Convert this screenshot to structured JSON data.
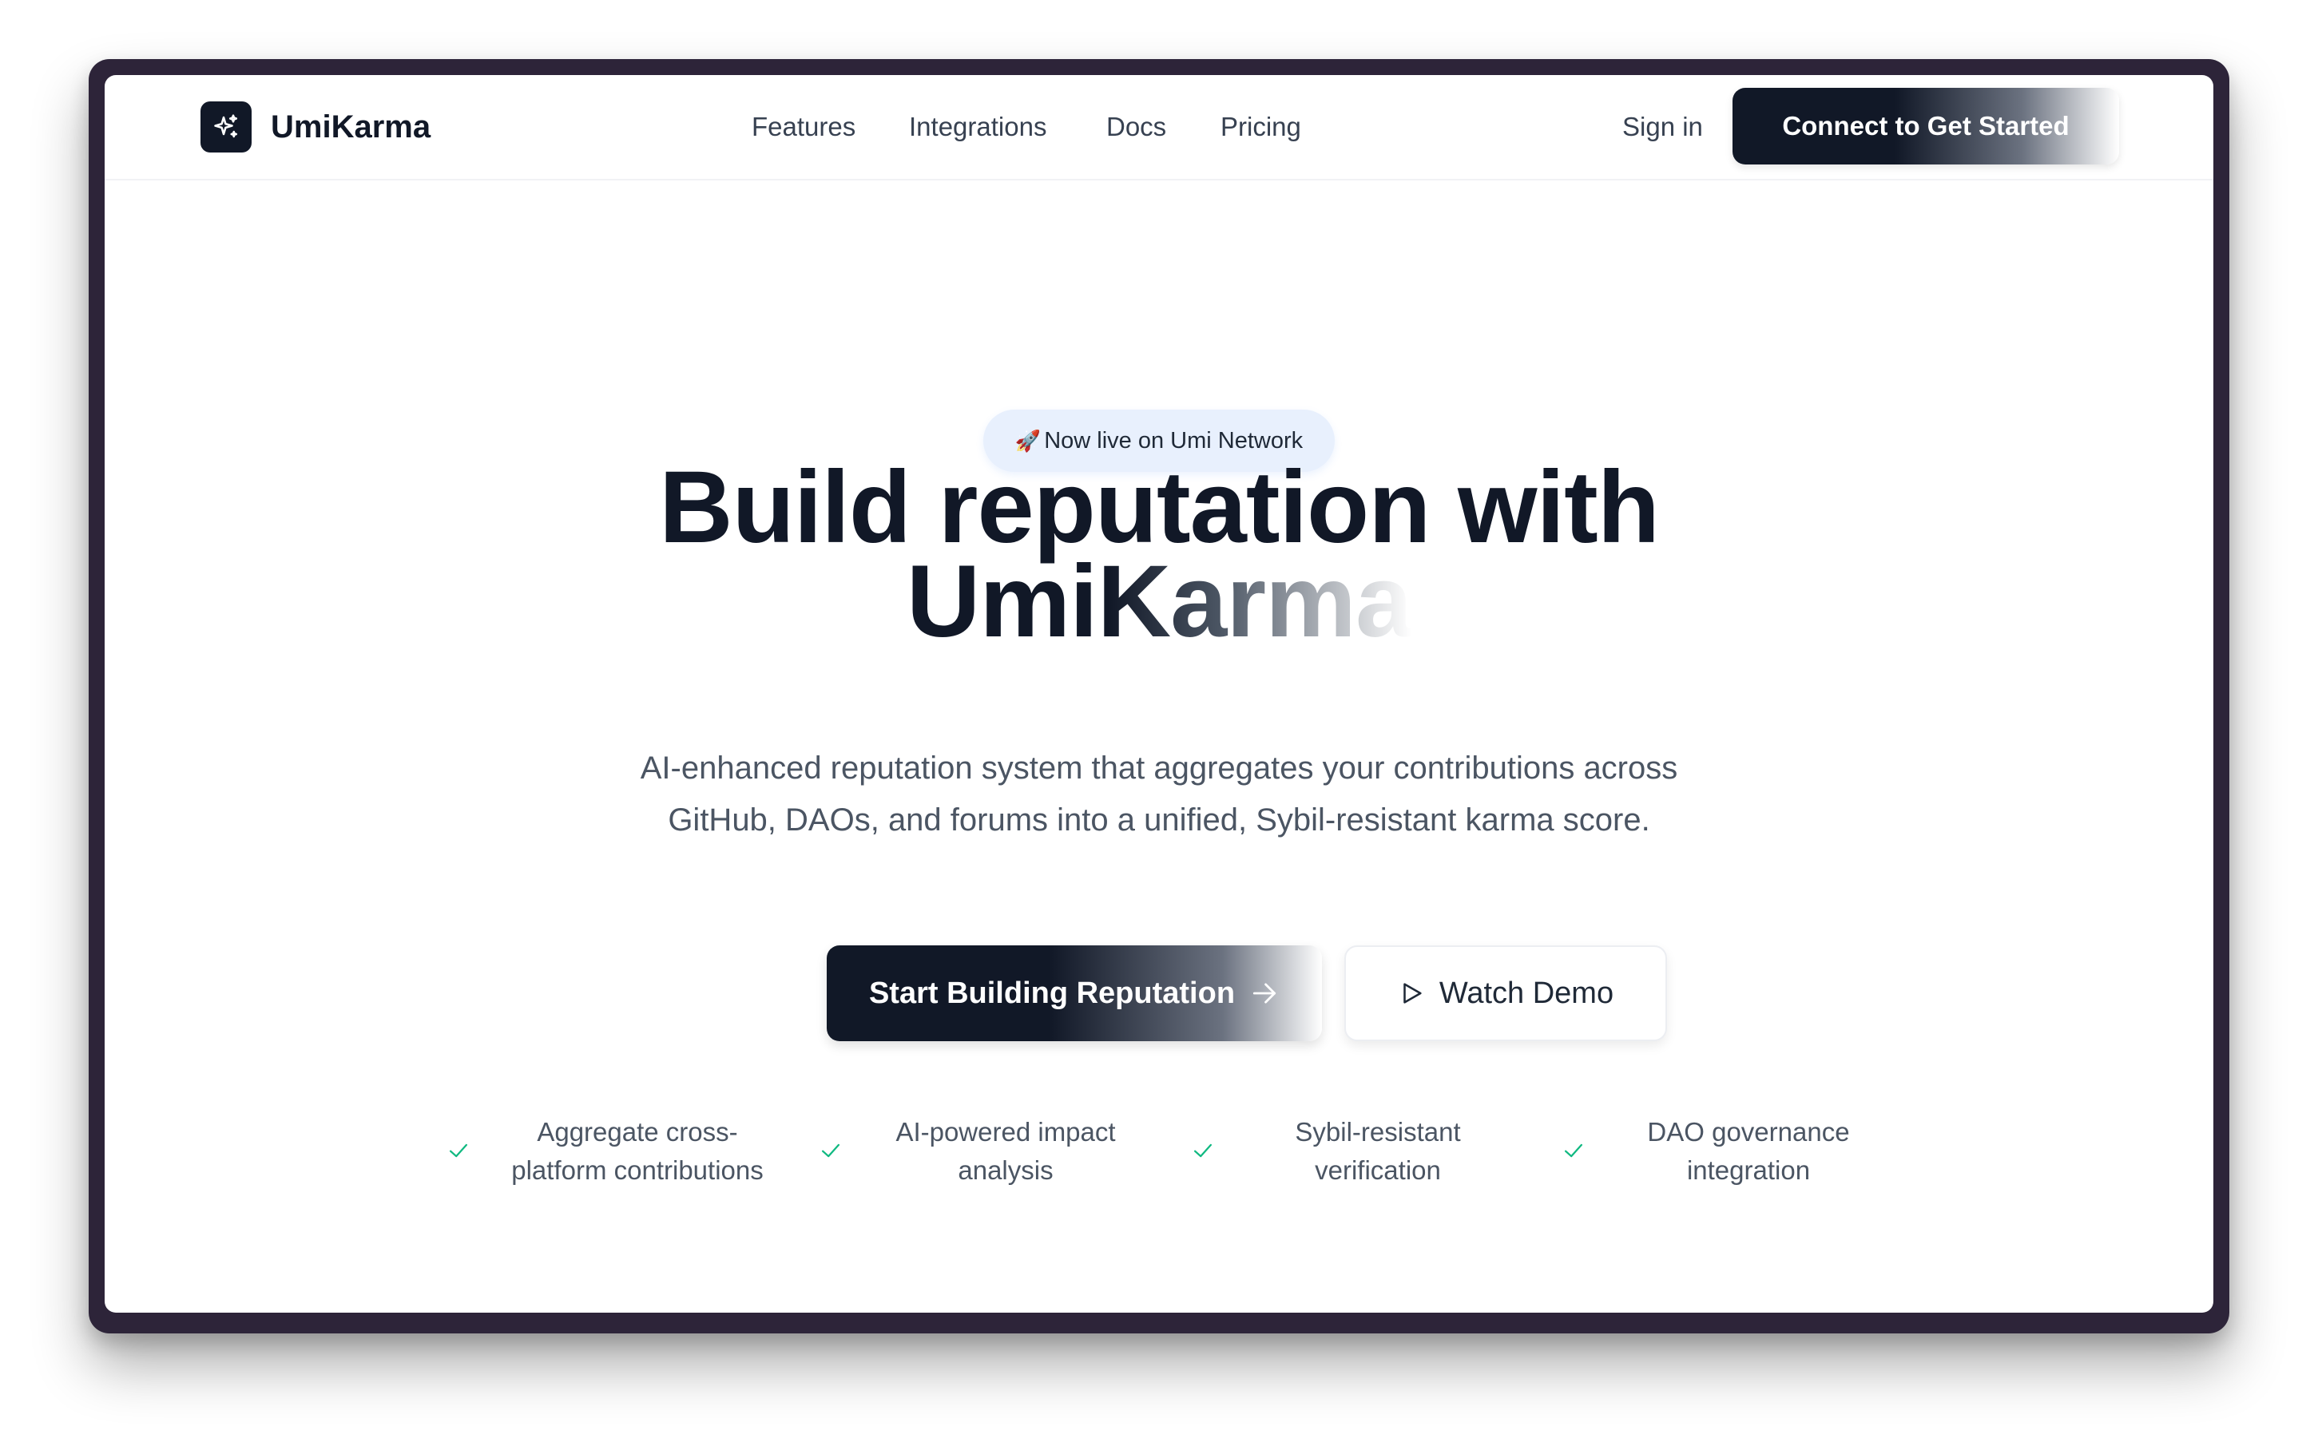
{
  "brand": {
    "name": "UmiKarma",
    "logo_icon": "sparkles-icon"
  },
  "nav": {
    "links": [
      "Features",
      "Integrations",
      "Docs",
      "Pricing"
    ],
    "sign_in": "Sign in",
    "connect_label": "Connect to Get Started"
  },
  "badge": {
    "emoji": "🚀",
    "text": "Now live on Umi Network"
  },
  "hero": {
    "headline_line1": "Build reputation with",
    "headline_line2": "UmiKarma",
    "subtitle": "AI-enhanced reputation system that aggregates your contributions across GitHub, DAOs, and forums into a unified, Sybil-resistant karma score."
  },
  "cta": {
    "primary_label": "Start Building Reputation",
    "primary_icon": "arrow-right-icon",
    "secondary_label": "Watch Demo",
    "secondary_icon": "play-icon"
  },
  "features": [
    {
      "line1": "Aggregate cross-",
      "line2": "platform contributions"
    },
    {
      "line1": "AI-powered impact",
      "line2": "analysis"
    },
    {
      "line1": "Sybil-resistant",
      "line2": "verification"
    },
    {
      "line1": "DAO governance",
      "line2": "integration"
    }
  ],
  "colors": {
    "primary": "#111827",
    "frame": "#2d2439",
    "badge_bg": "#e8f0fd",
    "check": "#10b981",
    "muted_text": "#4b5563"
  }
}
